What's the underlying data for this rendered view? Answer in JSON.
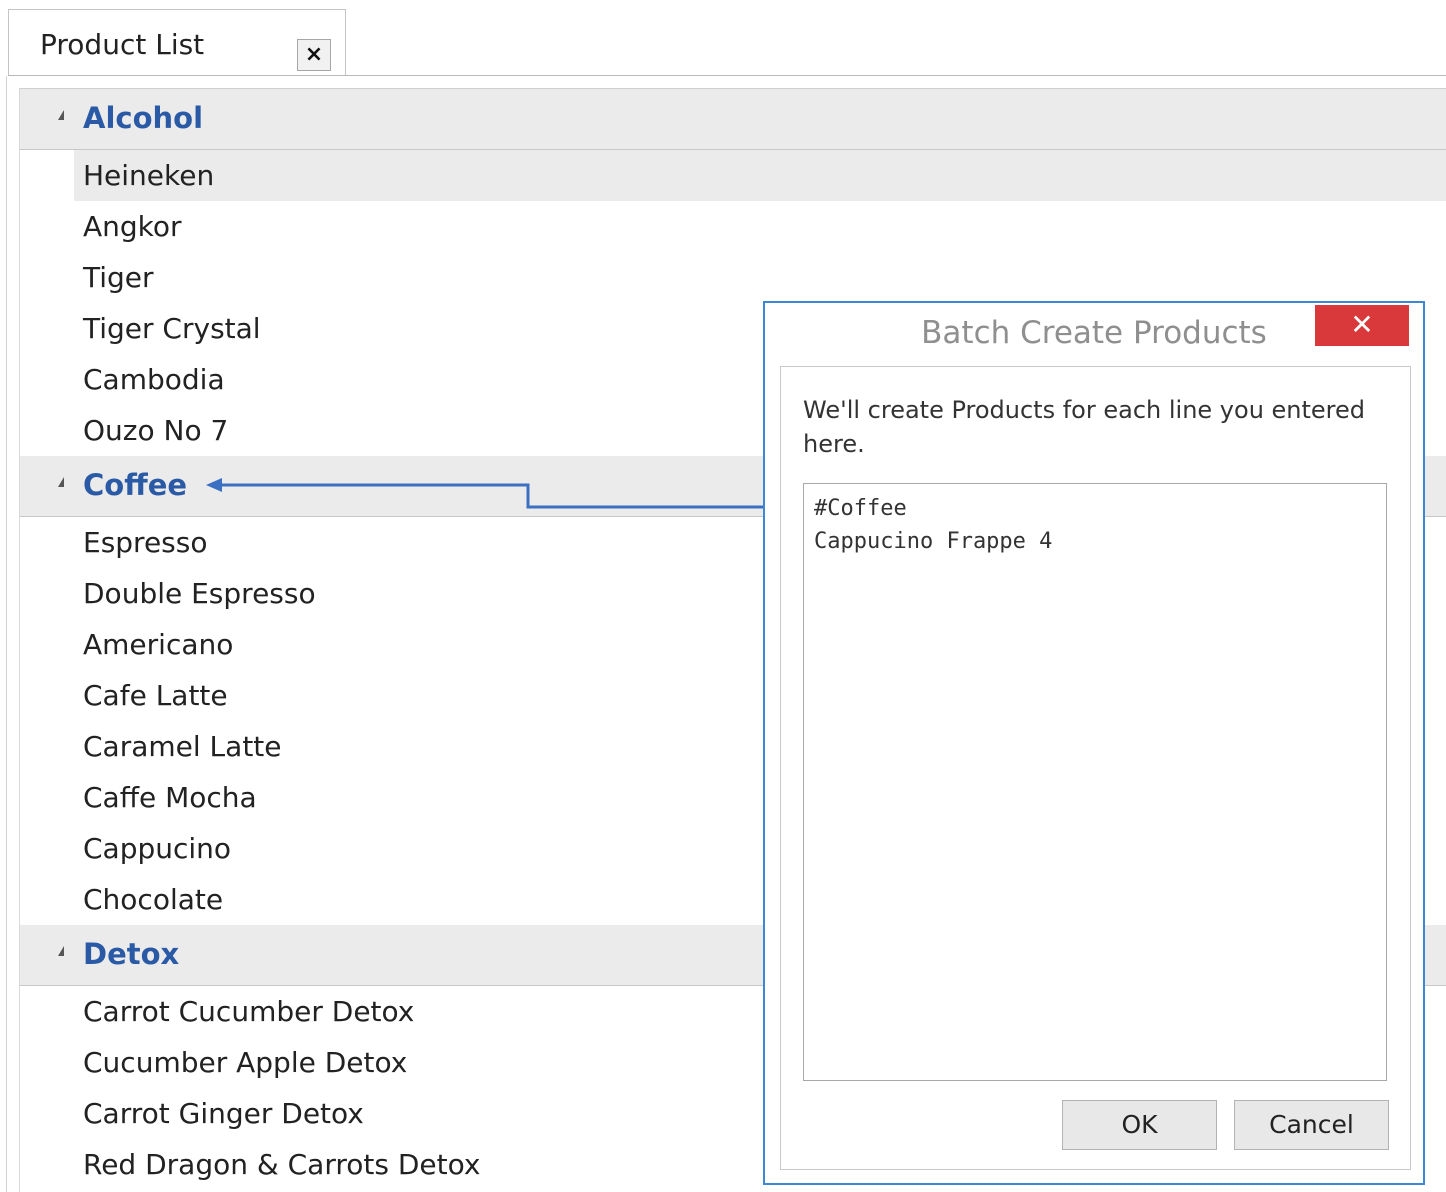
{
  "tab": {
    "label": "Product List",
    "close_glyph": "×"
  },
  "groups": [
    {
      "title": "Alcohol",
      "items": [
        "Heineken",
        "Angkor",
        "Tiger",
        "Tiger Crystal",
        "Cambodia",
        "Ouzo No 7"
      ],
      "selected_index": 0
    },
    {
      "title": "Coffee",
      "items": [
        "Espresso",
        "Double Espresso",
        "Americano",
        "Cafe Latte",
        "Caramel Latte",
        "Caffe Mocha",
        "Cappucino",
        "Chocolate"
      ]
    },
    {
      "title": "Detox",
      "items": [
        "Carrot Cucumber Detox",
        "Cucumber Apple Detox",
        "Carrot Ginger Detox",
        "Red Dragon & Carrots Detox"
      ]
    }
  ],
  "dialog": {
    "title": "Batch Create Products",
    "close_glyph": "✕",
    "description": "We'll create Products for each line you entered here.",
    "textarea_value": "#Coffee\nCappucino Frappe 4",
    "ok_label": "OK",
    "cancel_label": "Cancel"
  },
  "colors": {
    "group_title": "#2a5aa5",
    "dialog_border": "#3c87d6",
    "close_button": "#d9393b",
    "annotation_arrow": "#3a6fc2"
  },
  "icons": {
    "group_toggle": "expanded-triangle-icon",
    "arrow": "annotation-arrow-icon"
  }
}
